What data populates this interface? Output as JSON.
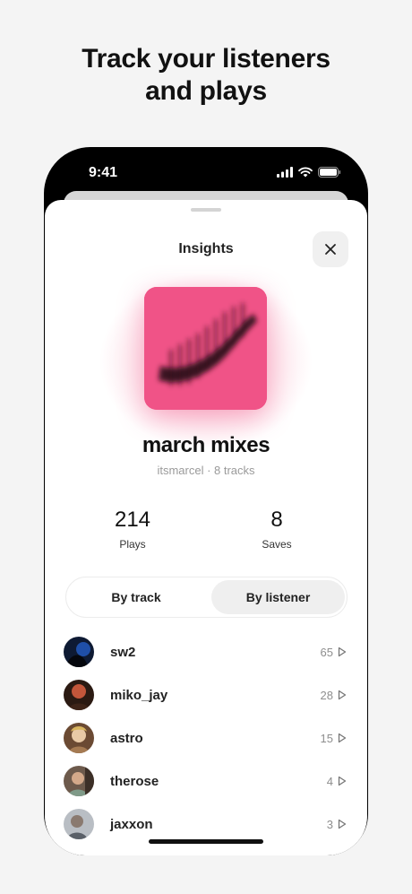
{
  "headline": {
    "line1": "Track your listeners",
    "line2": "and plays"
  },
  "status_bar": {
    "time": "9:41"
  },
  "sheet": {
    "title": "Insights",
    "close_icon": "close-icon"
  },
  "playlist": {
    "title": "march mixes",
    "meta": "itsmarcel · 8 tracks",
    "cover_color": "#f05387"
  },
  "stats": {
    "plays_value": "214",
    "plays_label": "Plays",
    "saves_value": "8",
    "saves_label": "Saves"
  },
  "segmented": {
    "options": [
      "By track",
      "By listener"
    ],
    "selected": "By listener"
  },
  "listeners": [
    {
      "name": "sw2",
      "plays": "65",
      "avatar_color": "#1d2a4a"
    },
    {
      "name": "miko_jay",
      "plays": "28",
      "avatar_color": "#5a2a1a"
    },
    {
      "name": "astro",
      "plays": "15",
      "avatar_color": "#c9a27a"
    },
    {
      "name": "therose",
      "plays": "4",
      "avatar_color": "#8a6a55"
    },
    {
      "name": "jaxxon",
      "plays": "3",
      "avatar_color": "#9aa0a6"
    }
  ]
}
